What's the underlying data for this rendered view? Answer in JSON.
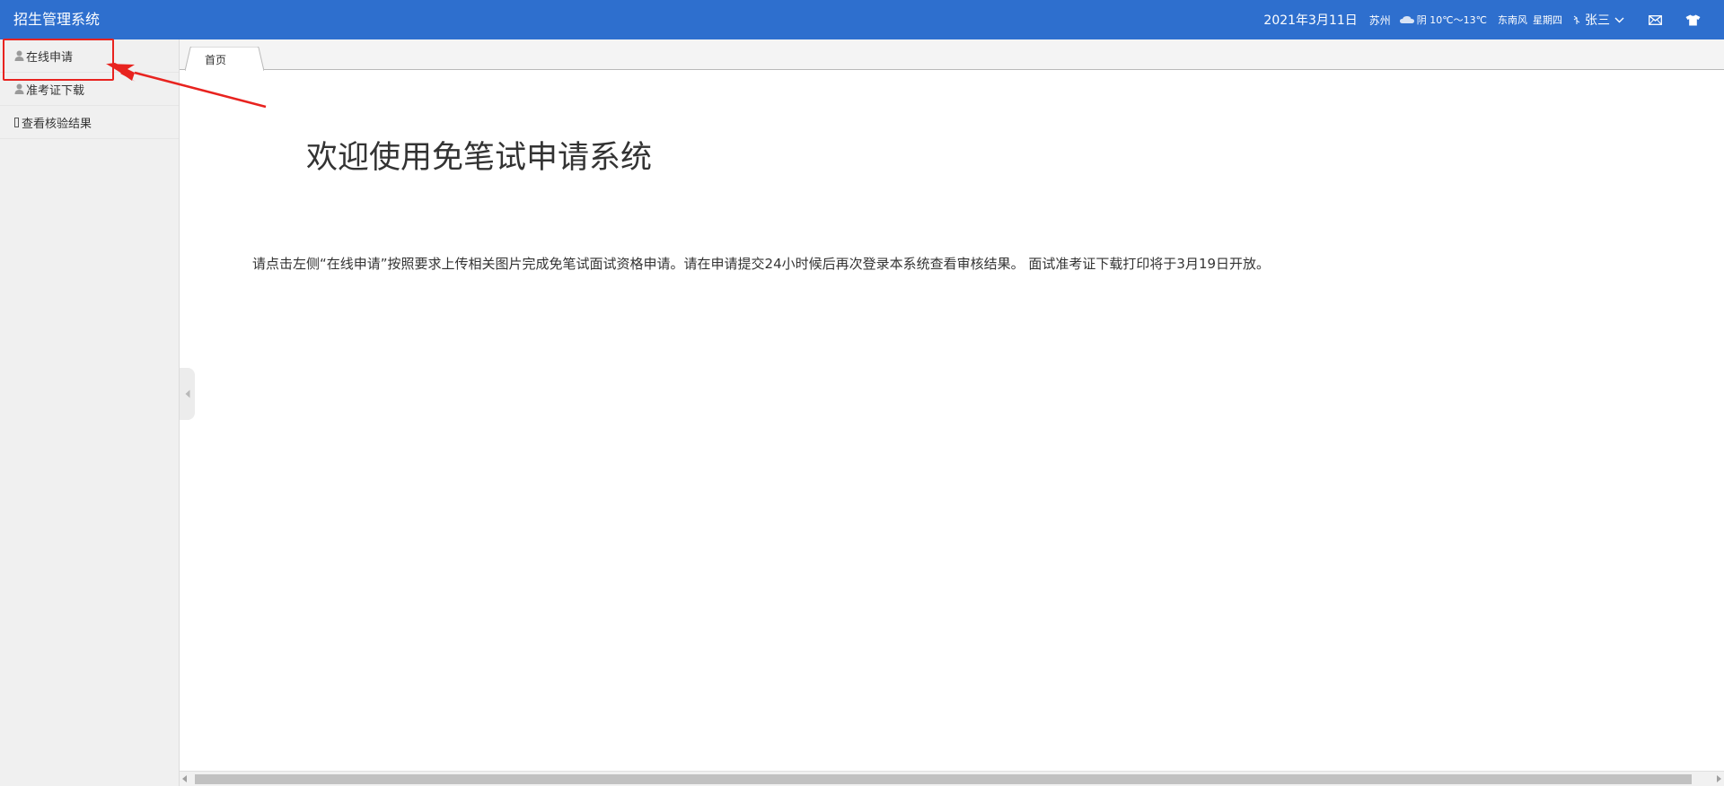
{
  "header": {
    "title": "招生管理系统",
    "date": "2021年3月11日",
    "city": "苏州",
    "weather": "阴 10℃～13℃",
    "wind": "东南风",
    "weekday": "星期四",
    "user": "张三"
  },
  "sidebar": {
    "items": [
      {
        "label": "在线申请",
        "icon": "user-icon"
      },
      {
        "label": "准考证下载",
        "icon": "user-icon"
      },
      {
        "label": "查看核验结果",
        "icon": "box-glyph-icon"
      }
    ]
  },
  "tabs": [
    {
      "label": "首页"
    }
  ],
  "main": {
    "welcome": "欢迎使用免笔试申请系统",
    "notice": "请点击左侧“在线申请”按照要求上传相关图片完成免笔试面试资格申请。请在申请提交24小时候后再次登录本系统查看审核结果。 面试准考证下载打印将于3月19日开放。"
  },
  "colors": {
    "header_bg": "#2e6fce",
    "annotation": "#e8231f"
  }
}
